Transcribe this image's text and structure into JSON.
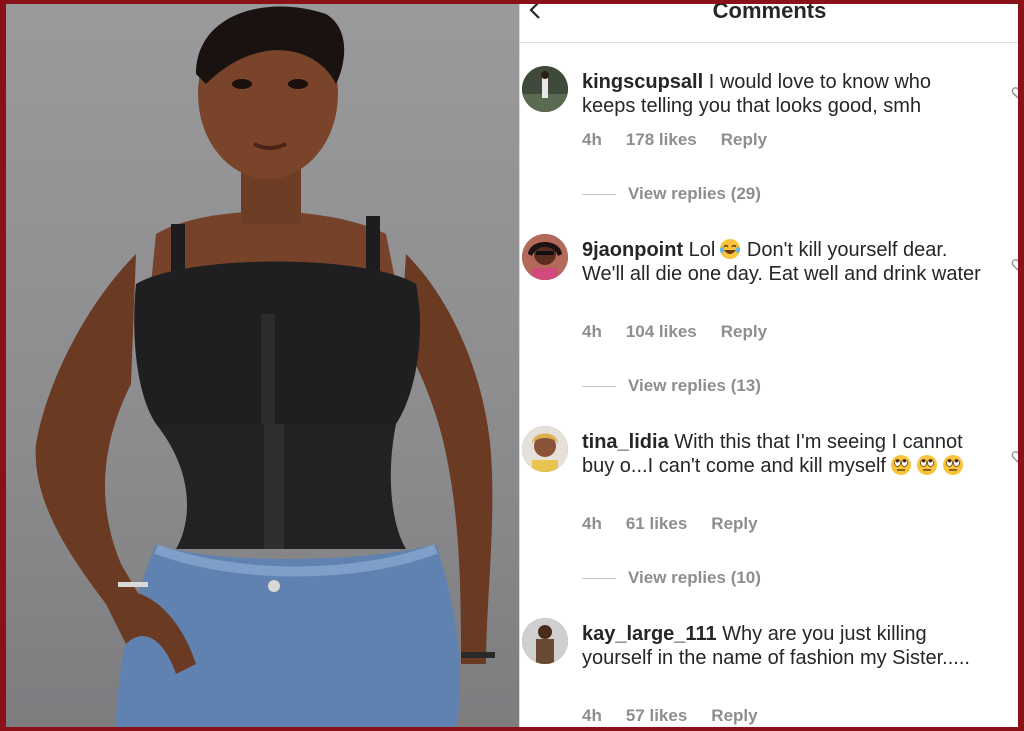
{
  "header": {
    "title": "Comments"
  },
  "comments": [
    {
      "username": "kingscupsall",
      "text": " I would love to know who keeps telling you that looks good, smh",
      "time": "4h",
      "likes": "178 likes",
      "reply": "Reply",
      "view_replies": "View replies (29)"
    },
    {
      "username": "9jaonpoint",
      "text": " Lol",
      "text_after_emoji": " Don't kill yourself dear. We'll all die one day. Eat well and drink water",
      "time": "4h",
      "likes": "104 likes",
      "reply": "Reply",
      "view_replies": "View replies (13)"
    },
    {
      "username": "tina_lidia",
      "text": " With this that I'm seeing I cannot buy o...I  can't come and kill myself",
      "time": "4h",
      "likes": "61 likes",
      "reply": "Reply",
      "view_replies": "View replies (10)"
    },
    {
      "username": "kay_large_111",
      "text": " Why are you just killing yourself in the name of fashion my Sister.....",
      "time": "4h",
      "likes": "57 likes",
      "reply": "Reply"
    }
  ],
  "icons": {
    "back": "chevron-left-icon",
    "like": "heart-icon",
    "emoji_laugh": "tears-of-joy-emoji",
    "emoji_eyeroll": "eye-roll-emoji"
  },
  "colors": {
    "frame": "#8b1118",
    "secondary_text": "#8e8e8e",
    "primary_text": "#262626"
  }
}
